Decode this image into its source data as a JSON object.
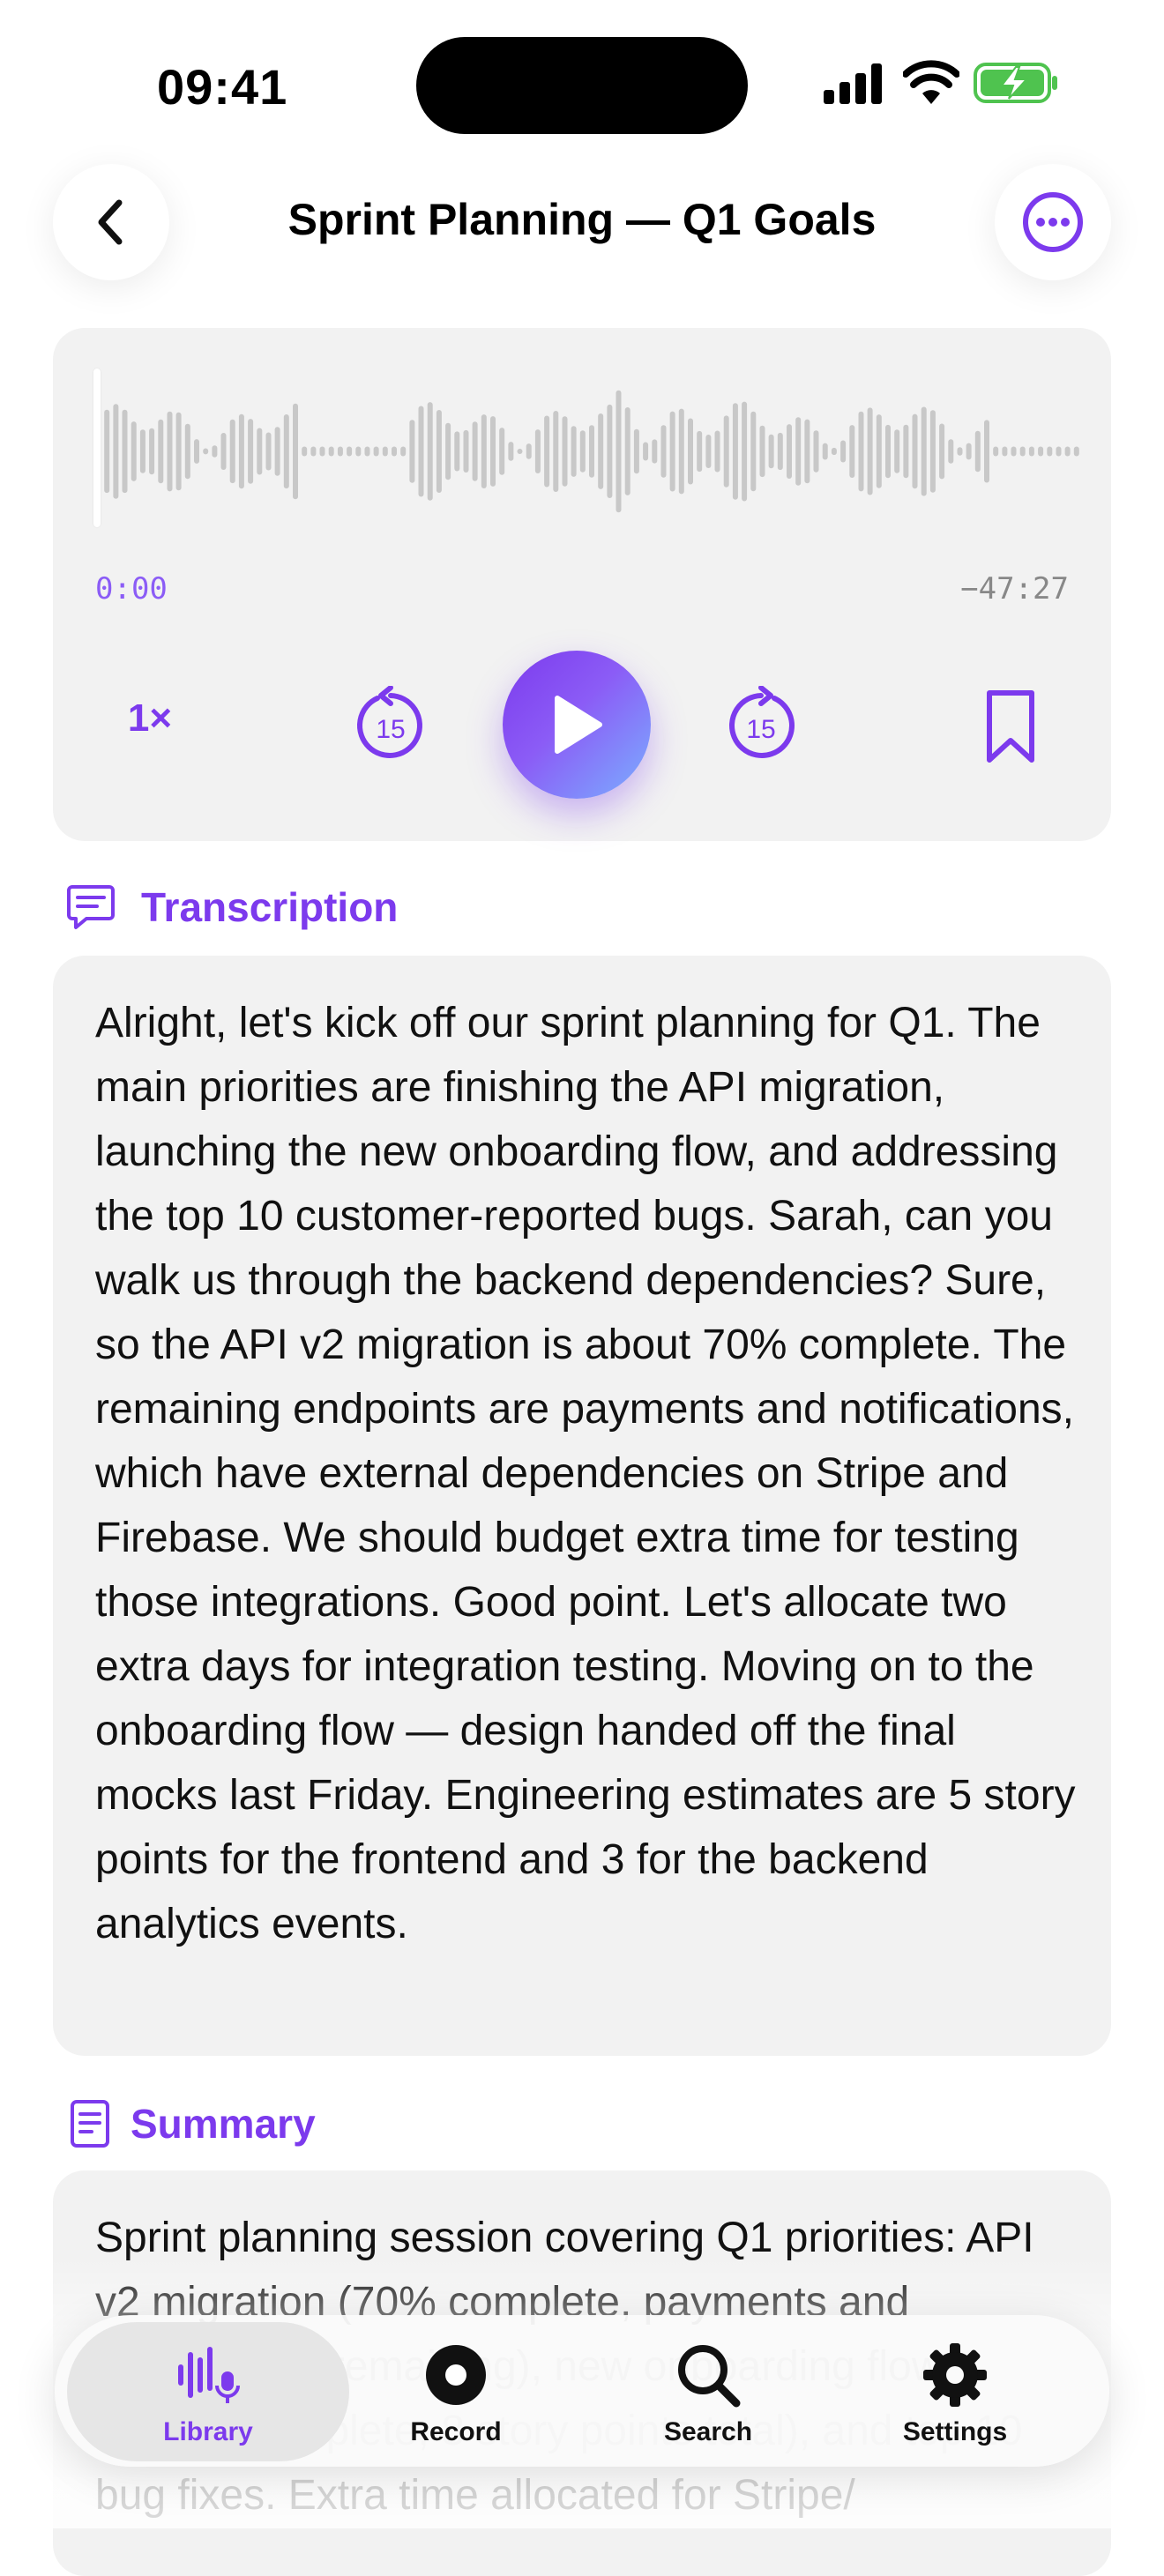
{
  "status_bar": {
    "time": "09:41"
  },
  "nav": {
    "title": "Sprint Planning — Q1 Goals",
    "back_icon": "chevron-left-icon",
    "more_icon": "ellipsis-circle-icon"
  },
  "player": {
    "elapsed": "0:00",
    "remaining": "−47:27",
    "speed": "1×",
    "skip_back_label": "15",
    "skip_forward_label": "15",
    "progress": 0.0
  },
  "transcription": {
    "heading": "Transcription",
    "text": "Alright, let's kick off our sprint planning for Q1. The main priorities are finishing the API migration, launching the new onboarding flow, and addressing the top 10 customer-reported bugs. Sarah, can you walk us through the backend dependencies? Sure, so the API v2 migration is about 70% complete. The remaining endpoints are payments and notifications, which have external dependencies on Stripe and Firebase. We should budget extra time for testing those integrations. Good point. Let's allocate two extra days for integration testing. Moving on to the onboarding flow — design handed off the final mocks last Friday. Engineering estimates are 5 story points for the frontend and 3 for the backend analytics events."
  },
  "summary": {
    "heading": "Summary",
    "text": "Sprint planning session covering Q1 priorities: API v2 migration (70% complete, payments and notifications remaining), new onboarding flow (design complete, 8 story points total), and top 10 bug fixes. Extra time allocated for Stripe/"
  },
  "tabs": [
    {
      "label": "Library",
      "icon": "waveform-mic-icon",
      "active": true
    },
    {
      "label": "Record",
      "icon": "record-icon",
      "active": false
    },
    {
      "label": "Search",
      "icon": "magnifier-icon",
      "active": false
    },
    {
      "label": "Settings",
      "icon": "gear-icon",
      "active": false
    }
  ],
  "colors": {
    "accent": "#7c3aed",
    "accent_light": "#8b5cf6",
    "card_bg": "#f2f2f2",
    "waveform": "#c8c8c8"
  }
}
